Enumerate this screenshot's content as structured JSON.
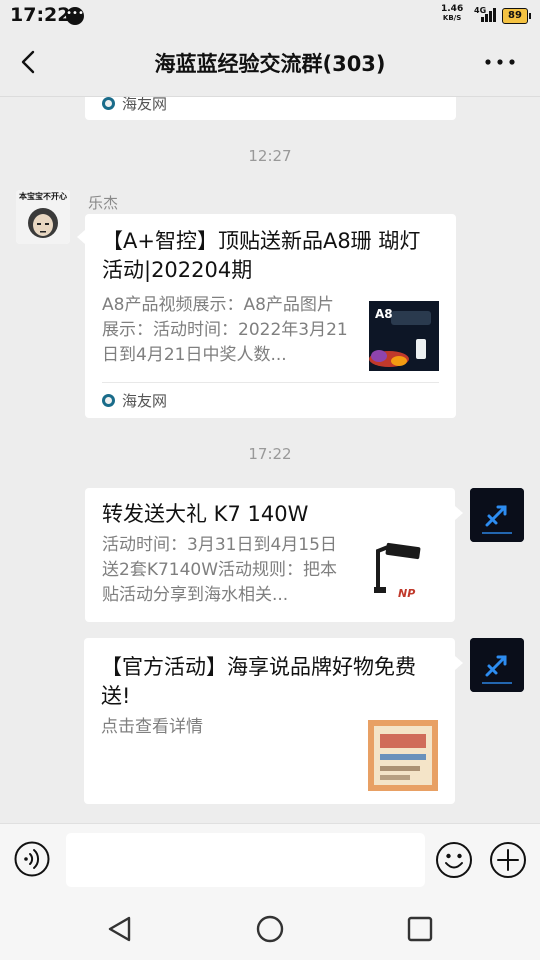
{
  "status_bar": {
    "time": "17:22",
    "notification_icon": "chat-bubble-dots-icon",
    "speed_value": "1.46",
    "speed_unit": "KB/S",
    "network": "4G",
    "battery": "89"
  },
  "header": {
    "title": "海蓝蓝经验交流群(303)",
    "back_icon": "chevron-left-icon",
    "more_icon": "more-dots-icon"
  },
  "messages": [
    {
      "type": "source_stub",
      "source": "海友网"
    },
    {
      "type": "timestamp",
      "text": "12:27"
    },
    {
      "type": "link_card",
      "side": "left",
      "sender": "乐杰",
      "avatar_caption": "本宝宝不开心",
      "title": "【A+智控】顶贴送新品A8珊 瑚灯活动|202204期",
      "description": "A8产品视频展示：A8产品图片展示：活动时间：2022年3月21日到4月21日中奖人数...",
      "thumb_label": "A8",
      "source": "海友网"
    },
    {
      "type": "timestamp",
      "text": "17:22"
    },
    {
      "type": "link_card",
      "side": "right",
      "title": "转发送大礼 K7 140W",
      "description": "活动时间：3月31日到4月15日送2套K7140W活动规则：把本贴活动分享到海水相关...",
      "thumb_label": "NP"
    },
    {
      "type": "link_card",
      "side": "right",
      "title": "【官方活动】海享说品牌好物免费送!",
      "description": "点击查看详情"
    }
  ],
  "input_bar": {
    "voice_icon": "voice-icon",
    "emoji_icon": "emoji-smile-icon",
    "plus_icon": "plus-circle-icon",
    "value": ""
  },
  "nav_bar": {
    "back_icon": "nav-back-triangle-icon",
    "home_icon": "nav-home-circle-icon",
    "recents_icon": "nav-recents-square-icon"
  },
  "colors": {
    "background": "#ededed",
    "bubble": "#ffffff",
    "muted_text": "#7f7f7f",
    "timestamp": "#999999"
  }
}
